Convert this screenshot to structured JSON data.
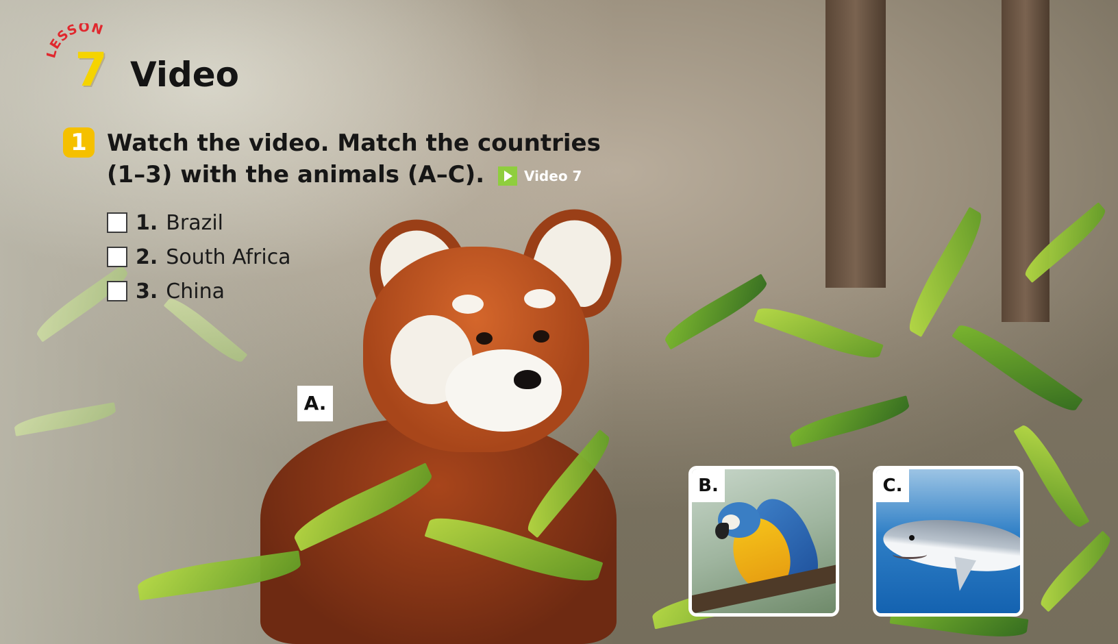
{
  "lesson": {
    "arc_label": "LESSON",
    "number": "7",
    "title": "Video"
  },
  "exercise": {
    "number": "1",
    "instruction": "Watch the video. Match the countries (1–3) with the animals (A–C).",
    "video_label": "Video 7"
  },
  "countries": [
    {
      "num": "1.",
      "name": "Brazil"
    },
    {
      "num": "2.",
      "name": "South Africa"
    },
    {
      "num": "3.",
      "name": "China"
    }
  ],
  "animals": {
    "a_label": "A.",
    "b_label": "B.",
    "c_label": "C."
  },
  "colors": {
    "lesson_accent": "#e0282e",
    "number_yellow": "#f5d400",
    "badge_yellow": "#f5c000",
    "play_green": "#8fce3e"
  },
  "icons": {
    "play": "play-icon"
  }
}
